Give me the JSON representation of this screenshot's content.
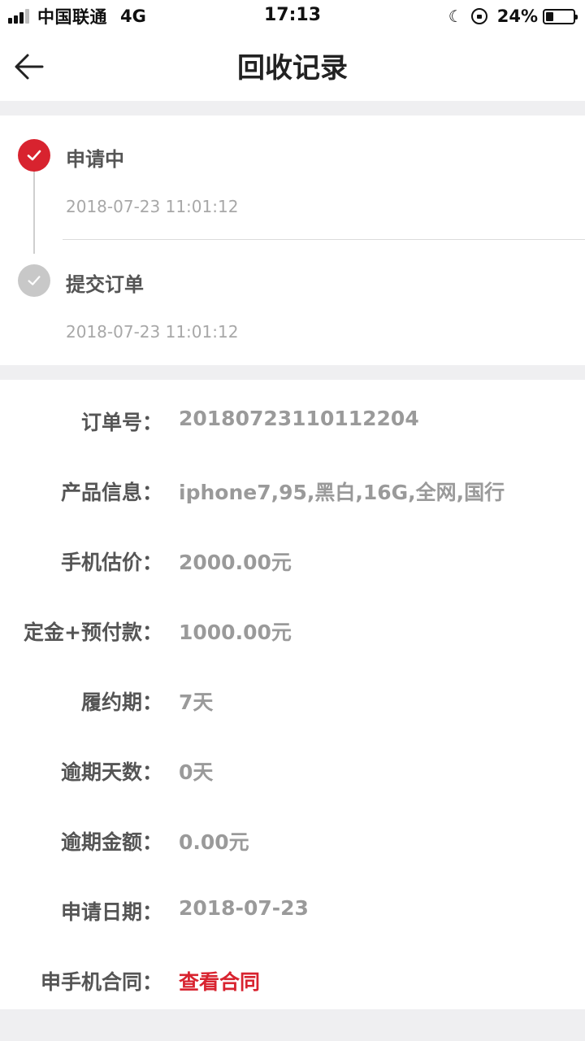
{
  "status_bar": {
    "carrier": "中国联通",
    "network": "4G",
    "time": "17:13",
    "battery_percent": "24%",
    "battery_level": 0.24,
    "signal_bars": 4,
    "signal_bars_filled": 3,
    "icons": [
      "signal-icon",
      "moon-icon",
      "rotation-lock-icon",
      "battery-icon"
    ]
  },
  "header": {
    "title": "回收记录",
    "back_icon": "back-arrow-icon"
  },
  "timeline": {
    "steps": [
      {
        "title": "申请中",
        "time": "2018-07-23 11:01:12",
        "state": "active",
        "color": "#d8232f",
        "icon": "check-icon"
      },
      {
        "title": "提交订单",
        "time": "2018-07-23 11:01:12",
        "state": "done",
        "color": "#c8c8c8",
        "icon": "check-icon"
      }
    ]
  },
  "details": {
    "rows": [
      {
        "label": "订单号：",
        "value": "20180723110112204"
      },
      {
        "label": "产品信息：",
        "value": "iphone7,95,黑白,16G,全网,国行"
      },
      {
        "label": "手机估价：",
        "value": "2000.00元"
      },
      {
        "label": "定金+预付款：",
        "value": "1000.00元"
      },
      {
        "label": "履约期：",
        "value": "7天"
      },
      {
        "label": "逾期天数：",
        "value": "0天"
      },
      {
        "label": "逾期金额：",
        "value": "0.00元"
      },
      {
        "label": "申请日期：",
        "value": "2018-07-23"
      },
      {
        "label": "申手机合同：",
        "value": "查看合同",
        "is_link": true
      }
    ]
  },
  "colors": {
    "accent": "#d8232f",
    "background": "#efeff1",
    "label": "#555555",
    "value": "#9a9a9a"
  }
}
